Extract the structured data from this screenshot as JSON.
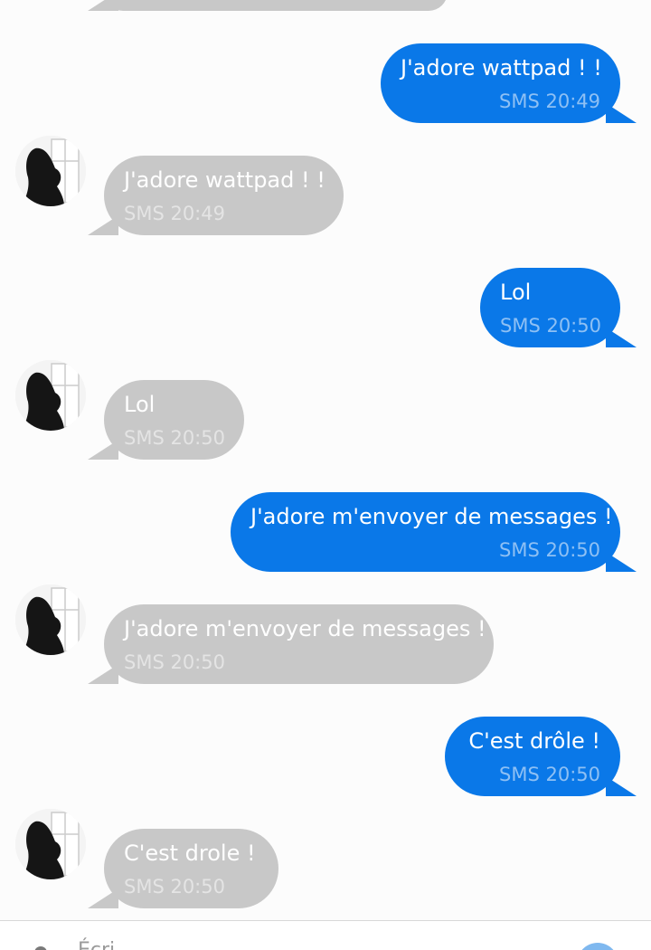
{
  "thread": {
    "messages": [
      {
        "direction": "out",
        "text": "J'adore wattpad ! !",
        "meta": "SMS 20:49"
      },
      {
        "direction": "in",
        "text": "J'adore wattpad ! !",
        "meta": "SMS 20:49"
      },
      {
        "direction": "out",
        "text": "Lol",
        "meta": "SMS 20:50"
      },
      {
        "direction": "in",
        "text": "Lol",
        "meta": "SMS 20:50"
      },
      {
        "direction": "out",
        "text": "J'adore m'envoyer de messages !",
        "meta": "SMS 20:50"
      },
      {
        "direction": "in",
        "text": "J'adore m'envoyer de messages !",
        "meta": "SMS 20:50"
      },
      {
        "direction": "out",
        "text": "C'est drôle !",
        "meta": "SMS 20:50"
      },
      {
        "direction": "in",
        "text": "C'est drole !",
        "meta": "SMS 20:50"
      }
    ]
  },
  "composer": {
    "placeholder": "Écri"
  },
  "colors": {
    "outgoing_bubble": "#0a78e8",
    "incoming_bubble": "#c8c8c8",
    "background": "#fcfcfc"
  },
  "icons": {
    "attach": "attach-icon",
    "send": "send-icon"
  }
}
